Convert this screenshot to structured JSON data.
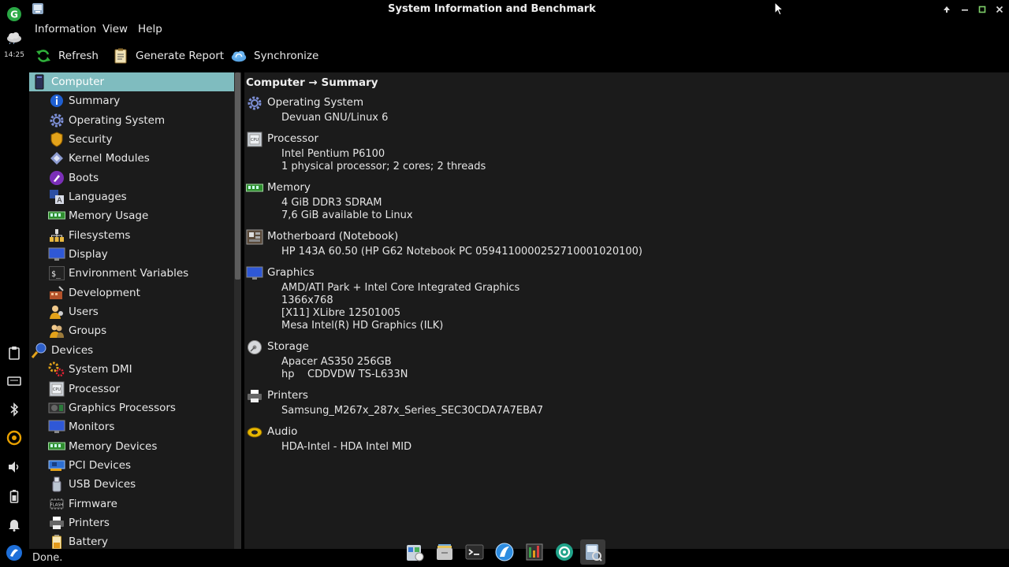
{
  "window": {
    "title": "System Information and Benchmark"
  },
  "system_clock": "14:25",
  "menu": {
    "information": "Information",
    "view": "View",
    "help": "Help"
  },
  "toolbar": {
    "refresh": "Refresh",
    "generate_report": "Generate Report",
    "synchronize": "Synchronize"
  },
  "tree": {
    "computer": "Computer",
    "summary": "Summary",
    "operating_system": "Operating System",
    "security": "Security",
    "kernel_modules": "Kernel Modules",
    "boots": "Boots",
    "languages": "Languages",
    "memory_usage": "Memory Usage",
    "filesystems": "Filesystems",
    "display": "Display",
    "environment_variables": "Environment Variables",
    "development": "Development",
    "users": "Users",
    "groups": "Groups",
    "devices": "Devices",
    "system_dmi": "System DMI",
    "processor": "Processor",
    "graphics_processors": "Graphics Processors",
    "monitors": "Monitors",
    "memory_devices": "Memory Devices",
    "pci_devices": "PCI Devices",
    "usb_devices": "USB Devices",
    "firmware": "Firmware",
    "printers": "Printers",
    "battery": "Battery"
  },
  "detail": {
    "header": "Computer → Summary",
    "os": {
      "title": "Operating System",
      "lines": [
        "Devuan GNU/Linux 6"
      ]
    },
    "processor": {
      "title": "Processor",
      "lines": [
        "Intel Pentium P6100",
        "1 physical processor; 2 cores; 2 threads"
      ]
    },
    "memory": {
      "title": "Memory",
      "lines": [
        "4 GiB DDR3 SDRAM",
        "7,6 GiB available to Linux"
      ]
    },
    "motherboard": {
      "title": "Motherboard (Notebook)",
      "lines": [
        "HP 143A 60.50 (HP G62 Notebook PC 059411000025271000102010​0)"
      ]
    },
    "graphics": {
      "title": "Graphics",
      "lines": [
        "AMD/ATI Park + Intel Core Integrated Graphics",
        "1366x768",
        "[X11] XLibre 12501005",
        "Mesa Intel(R) HD Graphics (ILK)"
      ]
    },
    "storage": {
      "title": "Storage",
      "lines": [
        "Apacer AS350 256GB",
        "hp    CDDVDW TS-L633N"
      ]
    },
    "printers": {
      "title": "Printers",
      "lines": [
        "Samsung_M267x_287x_Series_SEC30CDA7A7EBA7"
      ]
    },
    "audio": {
      "title": "Audio",
      "lines": [
        "HDA-Intel - HDA Intel MID"
      ]
    }
  },
  "status": "Done.",
  "colors": {
    "selection": "#7fbcbf",
    "panel": "#1b1b1b",
    "background": "#000000"
  }
}
